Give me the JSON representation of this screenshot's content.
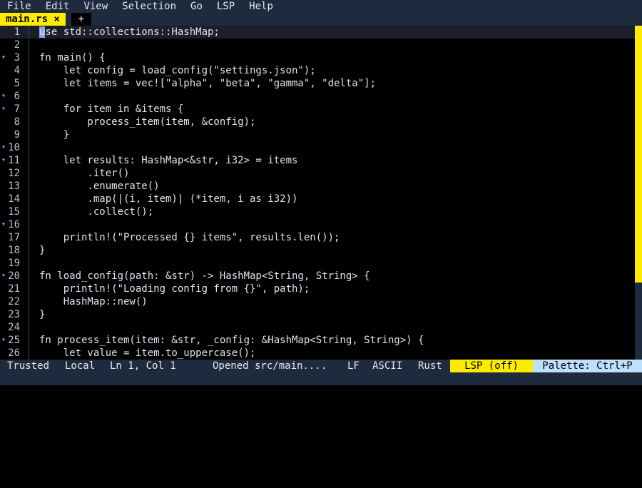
{
  "menu": [
    "File",
    "Edit",
    "View",
    "Selection",
    "Go",
    "LSP",
    "Help"
  ],
  "tabs": [
    {
      "label": "main.rs ×",
      "active": true
    },
    {
      "label": "+",
      "active": false
    }
  ],
  "editor": {
    "cursor_line": 1,
    "lines": [
      {
        "n": "1",
        "fold": false,
        "text": "use std::collections::HashMap;"
      },
      {
        "n": "2",
        "fold": false,
        "text": ""
      },
      {
        "n": "3",
        "fold": true,
        "text": "fn main() {"
      },
      {
        "n": "4",
        "fold": false,
        "text": "    let config = load_config(\"settings.json\");"
      },
      {
        "n": "5",
        "fold": false,
        "text": "    let items = vec![\"alpha\", \"beta\", \"gamma\", \"delta\"];"
      },
      {
        "n": "6",
        "fold": true,
        "text": ""
      },
      {
        "n": "7",
        "fold": true,
        "text": "    for item in &items {"
      },
      {
        "n": "8",
        "fold": false,
        "text": "        process_item(item, &config);"
      },
      {
        "n": "9",
        "fold": false,
        "text": "    }"
      },
      {
        "n": "10",
        "fold": true,
        "text": ""
      },
      {
        "n": "11",
        "fold": true,
        "text": "    let results: HashMap<&str, i32> = items"
      },
      {
        "n": "12",
        "fold": false,
        "text": "        .iter()"
      },
      {
        "n": "13",
        "fold": false,
        "text": "        .enumerate()"
      },
      {
        "n": "14",
        "fold": false,
        "text": "        .map(|(i, item)| (*item, i as i32))"
      },
      {
        "n": "15",
        "fold": false,
        "text": "        .collect();"
      },
      {
        "n": "16",
        "fold": true,
        "text": ""
      },
      {
        "n": "17",
        "fold": false,
        "text": "    println!(\"Processed {} items\", results.len());"
      },
      {
        "n": "18",
        "fold": false,
        "text": "}"
      },
      {
        "n": "19",
        "fold": false,
        "text": ""
      },
      {
        "n": "20",
        "fold": true,
        "text": "fn load_config(path: &str) -> HashMap<String, String> {"
      },
      {
        "n": "21",
        "fold": false,
        "text": "    println!(\"Loading config from {}\", path);"
      },
      {
        "n": "22",
        "fold": false,
        "text": "    HashMap::new()"
      },
      {
        "n": "23",
        "fold": false,
        "text": "}"
      },
      {
        "n": "24",
        "fold": false,
        "text": ""
      },
      {
        "n": "25",
        "fold": true,
        "text": "fn process_item(item: &str, _config: &HashMap<String, String>) {"
      },
      {
        "n": "26",
        "fold": false,
        "text": "    let value = item.to_uppercase();"
      }
    ]
  },
  "status": {
    "trust": "Trusted",
    "location": "Local",
    "position": "Ln 1, Col 1",
    "message": "Opened src/main....",
    "eol": "LF",
    "encoding": "ASCII",
    "language": "Rust",
    "lsp": "LSP (off)",
    "palette": "Palette: Ctrl+P"
  },
  "colors": {
    "accent": "#ffeb00",
    "panel": "#1e2a3d",
    "palette_bg": "#bde0ff"
  },
  "icons": {
    "fold": "fold-arrow-icon",
    "close_tab": "close-icon"
  }
}
